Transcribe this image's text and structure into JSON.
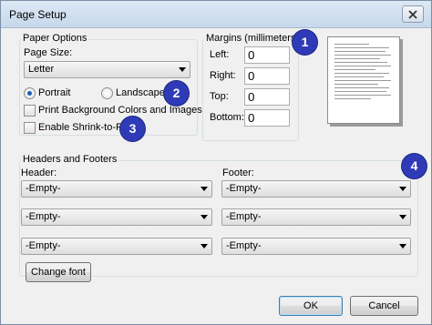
{
  "window": {
    "title": "Page Setup"
  },
  "icons": {
    "close": "close-icon"
  },
  "paper_options": {
    "group_label": "Paper Options",
    "page_size_label": "Page Size:",
    "page_size_value": "Letter",
    "portrait_label": "Portrait",
    "landscape_label": "Landscape",
    "orientation_selected": "Portrait",
    "print_background_label": "Print Background Colors and Images",
    "print_background_checked": false,
    "shrink_to_fit_label": "Enable Shrink-to-Fit",
    "shrink_to_fit_checked": false
  },
  "margins": {
    "group_label": "Margins (millimeters)",
    "left_label": "Left:",
    "left_value": "0",
    "right_label": "Right:",
    "right_value": "0",
    "top_label": "Top:",
    "top_value": "0",
    "bottom_label": "Bottom:",
    "bottom_value": "0"
  },
  "headers_footers": {
    "group_label": "Headers and Footers",
    "header_label": "Header:",
    "footer_label": "Footer:",
    "header_values": [
      "-Empty-",
      "-Empty-",
      "-Empty-"
    ],
    "footer_values": [
      "-Empty-",
      "-Empty-",
      "-Empty-"
    ],
    "change_font_label": "Change font"
  },
  "buttons": {
    "ok": "OK",
    "cancel": "Cancel"
  },
  "callouts": [
    "1",
    "2",
    "3",
    "4"
  ],
  "colors": {
    "callout": "#2f3bb6",
    "title_bar": "#c6d8ec",
    "radio_selected": "#1d5fb1"
  }
}
